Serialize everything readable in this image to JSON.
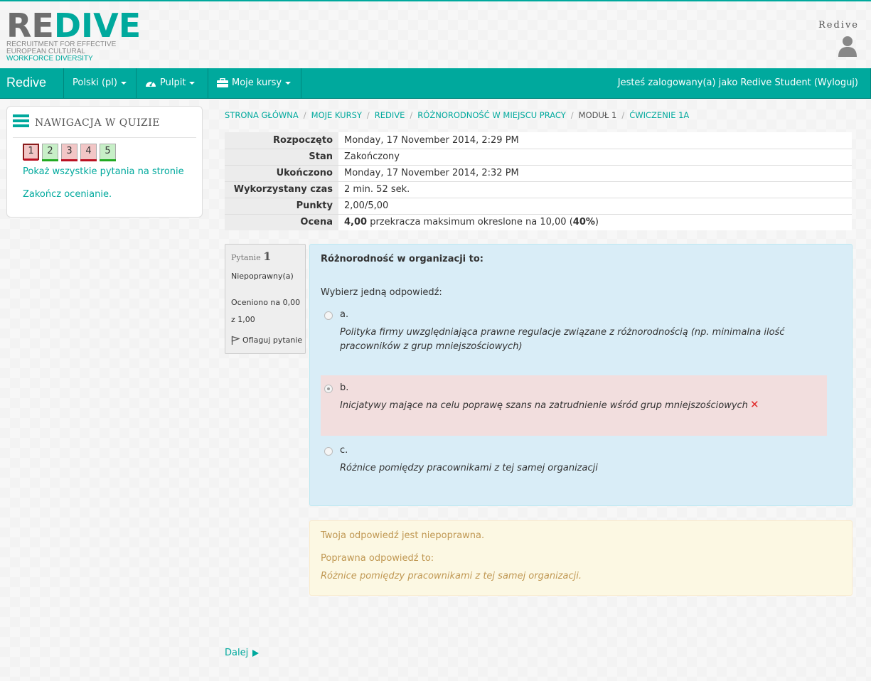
{
  "logo": {
    "wordmark_a": "RE",
    "wordmark_b": "DIVE",
    "line1": "RECRUITMENT FOR EFFECTIVE",
    "line2": "EUROPEAN CULTURAL",
    "line3": "WORKFORCE DIVERSITY"
  },
  "user": {
    "name": "Redive"
  },
  "navbar": {
    "brand": "Redive",
    "language": "Polski (pl)",
    "dashboard": "Pulpit",
    "my_courses": "Moje kursy",
    "login_prefix": "Jesteś zalogowany(a) jako ",
    "login_user": "Redive Student",
    "logout": "(Wyloguj)"
  },
  "quiz_nav": {
    "title": "NAWIGACJA W QUIZIE",
    "questions": [
      {
        "label": "1",
        "state": "wrong",
        "current": true
      },
      {
        "label": "2",
        "state": "right",
        "current": false
      },
      {
        "label": "3",
        "state": "wrong",
        "current": false
      },
      {
        "label": "4",
        "state": "wrong",
        "current": false
      },
      {
        "label": "5",
        "state": "right",
        "current": false
      }
    ],
    "show_all": "Pokaż wszystkie pytania na stronie",
    "finish": "Zakończ ocenianie."
  },
  "breadcrumb": {
    "home": "STRONA GŁÓWNA",
    "my_courses": "MOJE KURSY",
    "course": "REDIVE",
    "section": "RÓŻNORODNOŚĆ W MIEJSCU PRACY",
    "module": "MODUŁ 1",
    "exercise": "ĆWICZENIE 1A"
  },
  "summary": {
    "started_label": "Rozpoczęto",
    "started_value": "Monday, 17 November 2014, 2:29 PM",
    "state_label": "Stan",
    "state_value": "Zakończony",
    "completed_label": "Ukończono",
    "completed_value": "Monday, 17 November 2014, 2:32 PM",
    "time_label": "Wykorzystany czas",
    "time_value": "2 min. 52 sek.",
    "marks_label": "Punkty",
    "marks_value": "2,00/5,00",
    "grade_label": "Ocena",
    "grade_score": "4,00",
    "grade_middle": " przekracza maksimum okreslone na 10,00 (",
    "grade_percent": "40%",
    "grade_end": ")"
  },
  "question": {
    "label": "Pytanie",
    "number": "1",
    "state": "Niepoprawny(a)",
    "grade": "Oceniono na 0,00 z 1,00",
    "flag": "Oflaguj pytanie",
    "text": "Różnorodność w organizacji to:",
    "prompt": "Wybierz jedną odpowiedź:",
    "answers": [
      {
        "letter": "a.",
        "text": "Polityka firmy uwzględniająca prawne regulacje związane z różnorodnością (np. minimalna ilość pracowników z grup mniejszościowych)"
      },
      {
        "letter": "b.",
        "text": "Inicjatywy mające na celu poprawę szans na zatrudnienie wśród grup mniejszościowych"
      },
      {
        "letter": "c.",
        "text": "Różnice pomiędzy pracownikami z tej samej organizacji"
      }
    ]
  },
  "feedback": {
    "incorrect": "Twoja odpowiedź jest niepoprawna.",
    "correct_label": "Poprawna odpowiedź to:",
    "correct_answer": "Różnice pomiędzy pracownikami z tej samej organizacji."
  },
  "next": "Dalej"
}
